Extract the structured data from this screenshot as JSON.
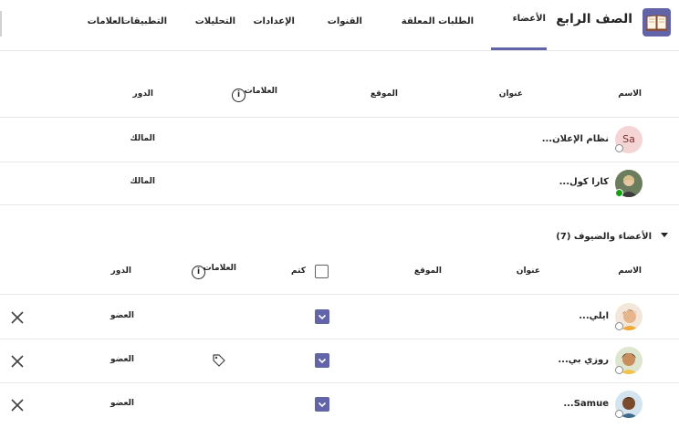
{
  "app": {
    "team_name": "الصف الرابع",
    "accent": "#6264a7",
    "icon": "book-icon"
  },
  "tabs": [
    {
      "label": "الأعضاء",
      "active": true
    },
    {
      "label": "الطلبات المعلقة"
    },
    {
      "label": "القنوات"
    },
    {
      "label": "الإعدادات"
    },
    {
      "label": "التحليلات"
    },
    {
      "label": "التطبيقات"
    },
    {
      "label": "العلامات"
    }
  ],
  "owners": {
    "columns": {
      "name": "الاسم",
      "title": "عنوان",
      "location": "الموقع",
      "tags": "العلامات",
      "role": "الدور"
    },
    "rows": [
      {
        "initials": "Sa",
        "name": "نظام الإعلان...",
        "role": "المالك",
        "status": "offline"
      },
      {
        "name": "كارا كول...",
        "role": "المالك",
        "status": "available"
      }
    ]
  },
  "members": {
    "section_label": "الأعضاء والضيوف (7)",
    "columns": {
      "name": "الاسم",
      "title": "عنوان",
      "location": "الموقع",
      "mute": "كتم",
      "tags": "العلامات",
      "role": "الدور"
    },
    "rows": [
      {
        "name": "ايلي...",
        "role": "العضو",
        "status": "offline",
        "muted": true,
        "has_tag_icon": false
      },
      {
        "name": "روزي بي...",
        "role": "العضو",
        "status": "offline",
        "muted": true,
        "has_tag_icon": true
      },
      {
        "name": "Samue...",
        "role": "العضو",
        "status": "offline",
        "muted": true,
        "has_tag_icon": false
      }
    ]
  }
}
